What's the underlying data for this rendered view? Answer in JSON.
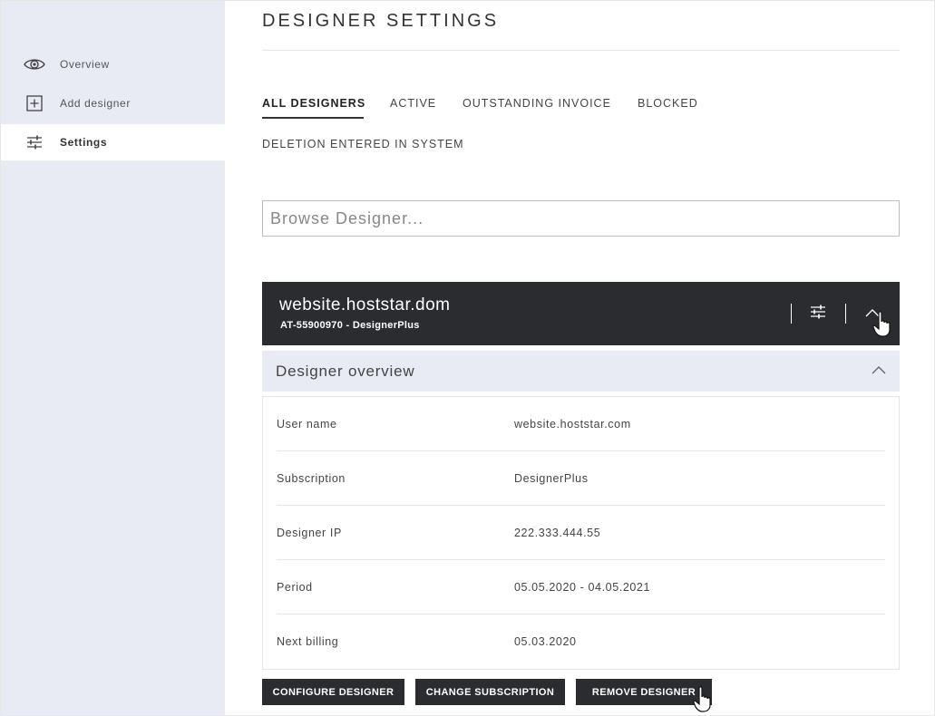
{
  "sidebar": {
    "items": [
      {
        "label": "Overview",
        "icon": "eye-icon"
      },
      {
        "label": "Add designer",
        "icon": "plus-square-icon"
      },
      {
        "label": "Settings",
        "icon": "sliders-icon",
        "active": true
      }
    ]
  },
  "page": {
    "title": "DESIGNER SETTINGS"
  },
  "tabs": [
    {
      "label": "ALL DESIGNERS",
      "active": true
    },
    {
      "label": "ACTIVE"
    },
    {
      "label": "OUTSTANDING INVOICE"
    },
    {
      "label": "BLOCKED"
    },
    {
      "label": "DELETION ENTERED IN SYSTEM"
    }
  ],
  "search": {
    "placeholder": "Browse Designer...",
    "value": ""
  },
  "card": {
    "host": "website.hoststar.dom",
    "subtitle": "AT-55900970 - DesignerPlus"
  },
  "overview": {
    "title": "Designer overview",
    "rows": [
      {
        "label": "User name",
        "value": "website.hoststar.com"
      },
      {
        "label": "Subscription",
        "value": "DesignerPlus"
      },
      {
        "label": "Designer IP",
        "value": "222.333.444.55"
      },
      {
        "label": "Period",
        "value": "05.05.2020 - 04.05.2021"
      },
      {
        "label": "Next billing",
        "value": "05.03.2020"
      }
    ]
  },
  "actions": {
    "configure": "CONFIGURE DESIGNER",
    "change": "CHANGE SUBSCRIPTION",
    "remove": "REMOVE DESIGNER"
  },
  "colors": {
    "sidebar_bg": "#e8ebf3",
    "dark": "#2b2c30",
    "border": "#e6e6e6"
  }
}
